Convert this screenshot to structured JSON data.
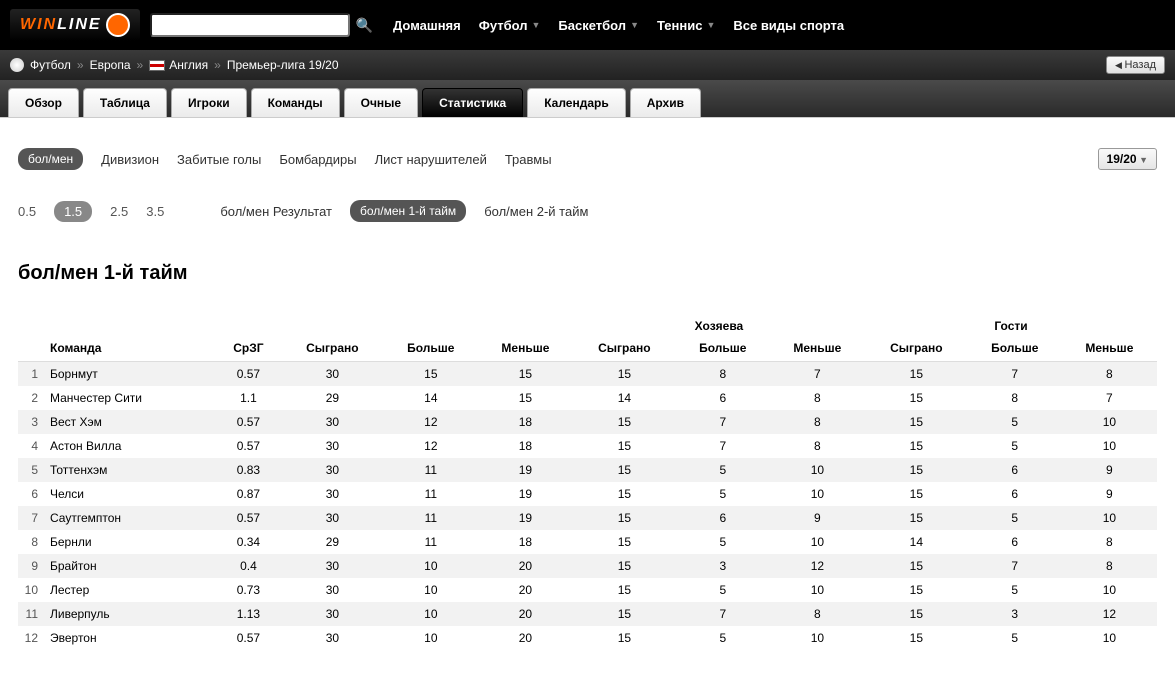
{
  "header": {
    "logo_text_left": "WIN",
    "logo_text_right": "LINE",
    "search_placeholder": "",
    "nav": [
      {
        "label": "Домашняя",
        "dropdown": false
      },
      {
        "label": "Футбол",
        "dropdown": true
      },
      {
        "label": "Баскетбол",
        "dropdown": true
      },
      {
        "label": "Теннис",
        "dropdown": true
      },
      {
        "label": "Все виды спорта",
        "dropdown": false
      }
    ]
  },
  "breadcrumb": {
    "items": [
      "Футбол",
      "Европа",
      "Англия",
      "Премьер-лига 19/20"
    ],
    "back": "Назад"
  },
  "tabs": [
    "Обзор",
    "Таблица",
    "Игроки",
    "Команды",
    "Очные",
    "Статистика",
    "Календарь",
    "Архив"
  ],
  "active_tab": 5,
  "subnav": {
    "active": "бол/мен",
    "items": [
      "Дивизион",
      "Забитые голы",
      "Бомбардиры",
      "Лист нарушителей",
      "Травмы"
    ],
    "season": "19/20"
  },
  "filters": {
    "values": [
      "0.5",
      "1.5",
      "2.5",
      "3.5"
    ],
    "active_value": "1.5",
    "modes": [
      "бол/мен Результат",
      "бол/мен 1-й тайм",
      "бол/мен 2-й тайм"
    ],
    "active_mode": 1
  },
  "title": "бол/мен 1-й тайм",
  "table": {
    "group_headers": [
      "",
      "",
      "Хозяева",
      "Гости"
    ],
    "headers": [
      "",
      "Команда",
      "СрЗГ",
      "Сыграно",
      "Больше",
      "Меньше",
      "Сыграно",
      "Больше",
      "Меньше",
      "Сыграно",
      "Больше",
      "Меньше"
    ],
    "rows": [
      {
        "rank": 1,
        "team": "Борнмут",
        "avg": "0.57",
        "p": 30,
        "o": 15,
        "u": 15,
        "hp": 15,
        "ho": 8,
        "hu": 7,
        "ap": 15,
        "ao": 7,
        "au": 8
      },
      {
        "rank": 2,
        "team": "Манчестер Сити",
        "avg": "1.1",
        "p": 29,
        "o": 14,
        "u": 15,
        "hp": 14,
        "ho": 6,
        "hu": 8,
        "ap": 15,
        "ao": 8,
        "au": 7
      },
      {
        "rank": 3,
        "team": "Вест Хэм",
        "avg": "0.57",
        "p": 30,
        "o": 12,
        "u": 18,
        "hp": 15,
        "ho": 7,
        "hu": 8,
        "ap": 15,
        "ao": 5,
        "au": 10
      },
      {
        "rank": 4,
        "team": "Астон Вилла",
        "avg": "0.57",
        "p": 30,
        "o": 12,
        "u": 18,
        "hp": 15,
        "ho": 7,
        "hu": 8,
        "ap": 15,
        "ao": 5,
        "au": 10
      },
      {
        "rank": 5,
        "team": "Тоттенхэм",
        "avg": "0.83",
        "p": 30,
        "o": 11,
        "u": 19,
        "hp": 15,
        "ho": 5,
        "hu": 10,
        "ap": 15,
        "ao": 6,
        "au": 9
      },
      {
        "rank": 6,
        "team": "Челси",
        "avg": "0.87",
        "p": 30,
        "o": 11,
        "u": 19,
        "hp": 15,
        "ho": 5,
        "hu": 10,
        "ap": 15,
        "ao": 6,
        "au": 9
      },
      {
        "rank": 7,
        "team": "Саутгемптон",
        "avg": "0.57",
        "p": 30,
        "o": 11,
        "u": 19,
        "hp": 15,
        "ho": 6,
        "hu": 9,
        "ap": 15,
        "ao": 5,
        "au": 10
      },
      {
        "rank": 8,
        "team": "Бернли",
        "avg": "0.34",
        "p": 29,
        "o": 11,
        "u": 18,
        "hp": 15,
        "ho": 5,
        "hu": 10,
        "ap": 14,
        "ao": 6,
        "au": 8
      },
      {
        "rank": 9,
        "team": "Брайтон",
        "avg": "0.4",
        "p": 30,
        "o": 10,
        "u": 20,
        "hp": 15,
        "ho": 3,
        "hu": 12,
        "ap": 15,
        "ao": 7,
        "au": 8
      },
      {
        "rank": 10,
        "team": "Лестер",
        "avg": "0.73",
        "p": 30,
        "o": 10,
        "u": 20,
        "hp": 15,
        "ho": 5,
        "hu": 10,
        "ap": 15,
        "ao": 5,
        "au": 10
      },
      {
        "rank": 11,
        "team": "Ливерпуль",
        "avg": "1.13",
        "p": 30,
        "o": 10,
        "u": 20,
        "hp": 15,
        "ho": 7,
        "hu": 8,
        "ap": 15,
        "ao": 3,
        "au": 12
      },
      {
        "rank": 12,
        "team": "Эвертон",
        "avg": "0.57",
        "p": 30,
        "o": 10,
        "u": 20,
        "hp": 15,
        "ho": 5,
        "hu": 10,
        "ap": 15,
        "ao": 5,
        "au": 10
      }
    ]
  }
}
